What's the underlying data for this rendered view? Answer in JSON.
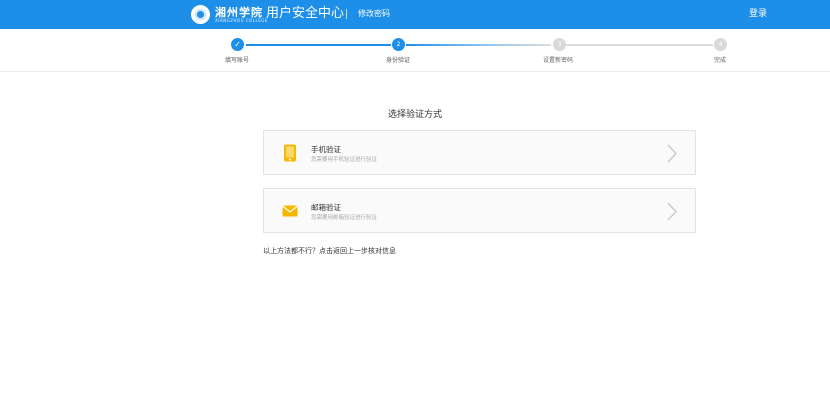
{
  "header": {
    "logo_text": "湘州学院",
    "logo_subtext": "XIANGZHOU COLLEGE",
    "app_title": "用户安全中心",
    "page_subtitle": "修改密码",
    "login_label": "登录"
  },
  "steps": [
    {
      "number": "✓",
      "label": "填写账号",
      "state": "done"
    },
    {
      "number": "2",
      "label": "身份验证",
      "state": "active"
    },
    {
      "number": "3",
      "label": "设置新密码",
      "state": "pending"
    },
    {
      "number": "4",
      "label": "完成",
      "state": "pending"
    }
  ],
  "main": {
    "title": "选择验证方式",
    "options": [
      {
        "title": "手机验证",
        "desc": "您需要用手机验证进行验证",
        "icon": "phone-icon"
      },
      {
        "title": "邮箱验证",
        "desc": "您需要用邮箱验证进行验证",
        "icon": "envelope-icon"
      }
    ],
    "fallback_text": "以上方法都不行？点击返回上一步核对信息"
  },
  "colors": {
    "primary": "#1e8fe8",
    "pending": "#d9d9d9",
    "icon_yellow": "#f5b800"
  }
}
